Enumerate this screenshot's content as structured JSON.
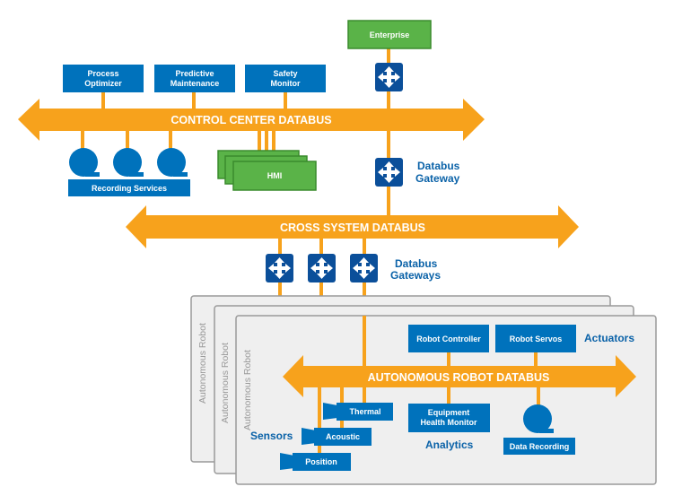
{
  "colors": {
    "blue": "#0072bc",
    "gateway_blue": "#0b4f9a",
    "orange": "#f7a21c",
    "green": "#5ab348",
    "green_border": "#3a8b2d",
    "panel": "#efefef"
  },
  "enterprise": "Enterprise",
  "control_center": {
    "bus_label": "CONTROL CENTER DATABUS",
    "apps": [
      [
        "Process",
        "Optimizer"
      ],
      [
        "Predictive",
        "Maintenance"
      ],
      [
        "Safety",
        "Monitor"
      ]
    ],
    "recording_label": "Recording Services",
    "hmi_label": "HMI",
    "gateway_label": [
      "Databus",
      "Gateway"
    ]
  },
  "cross_system": {
    "bus_label": "CROSS SYSTEM DATABUS",
    "gateway_label": [
      "Databus",
      "Gateways"
    ]
  },
  "robot": {
    "panel_label": "Autonomous Robot",
    "bus_label": "AUTONOMOUS ROBOT DATABUS",
    "robot_controller": "Robot Controller",
    "robot_servos": "Robot Servos",
    "actuators_label": "Actuators",
    "sensors_label": "Sensors",
    "sensors": [
      "Thermal",
      "Acoustic",
      "Position"
    ],
    "health_monitor": [
      "Equipment",
      "Health Monitor"
    ],
    "analytics_label": "Analytics",
    "data_recording": "Data Recording"
  },
  "icons": {
    "gateway": "four-way-arrows-icon",
    "recorder": "tape-reel-icon",
    "sensor": "camera-icon"
  }
}
